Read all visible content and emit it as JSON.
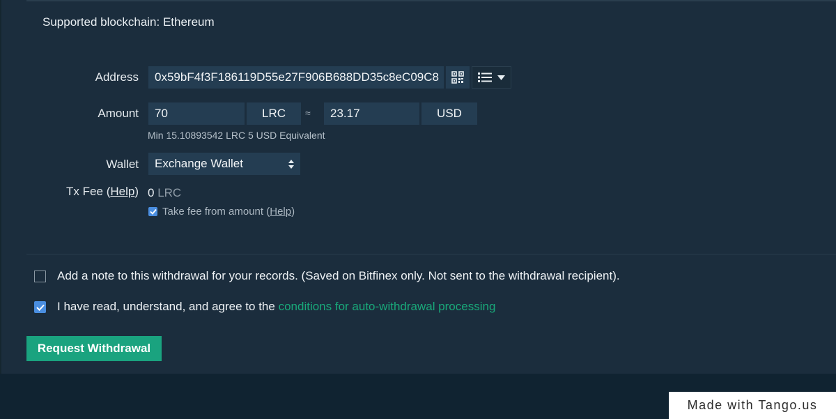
{
  "supported": "Supported blockchain: Ethereum",
  "form": {
    "address_label": "Address",
    "address_value": "0x59bF4f3F186119D55e27F906B688DD35c8eC09C8",
    "amount_label": "Amount",
    "amount_value": "70",
    "amount_currency": "LRC",
    "approx_symbol": "≈",
    "usd_value": "23.17",
    "usd_currency": "USD",
    "min_text": "Min 15.10893542 LRC 5 USD Equivalent",
    "wallet_label": "Wallet",
    "wallet_value": "Exchange Wallet",
    "txfee_label": "Tx Fee",
    "txfee_help": "Help",
    "txfee_value": "0",
    "txfee_unit": "LRC",
    "take_fee_text": "Take fee from amount",
    "take_fee_help": "Help"
  },
  "note_text": "Add a note to this withdrawal for your records. (Saved on Bitfinex only. Not sent to the withdrawal recipient).",
  "agree_text": "I have read, understand, and agree to the ",
  "agree_link": "conditions for auto-withdrawal processing",
  "request_button": "Request Withdrawal",
  "watermark": "Made with Tango.us",
  "icons": [
    "qr-code-icon",
    "list-icon",
    "caret-down-icon",
    "select-arrows-icon",
    "checkmark-icon"
  ],
  "colors": {
    "background": "#1b2d3d",
    "field": "#243d52",
    "accent": "#1aa37f",
    "link": "#19a97a",
    "checkbox": "#4a8ee0"
  }
}
